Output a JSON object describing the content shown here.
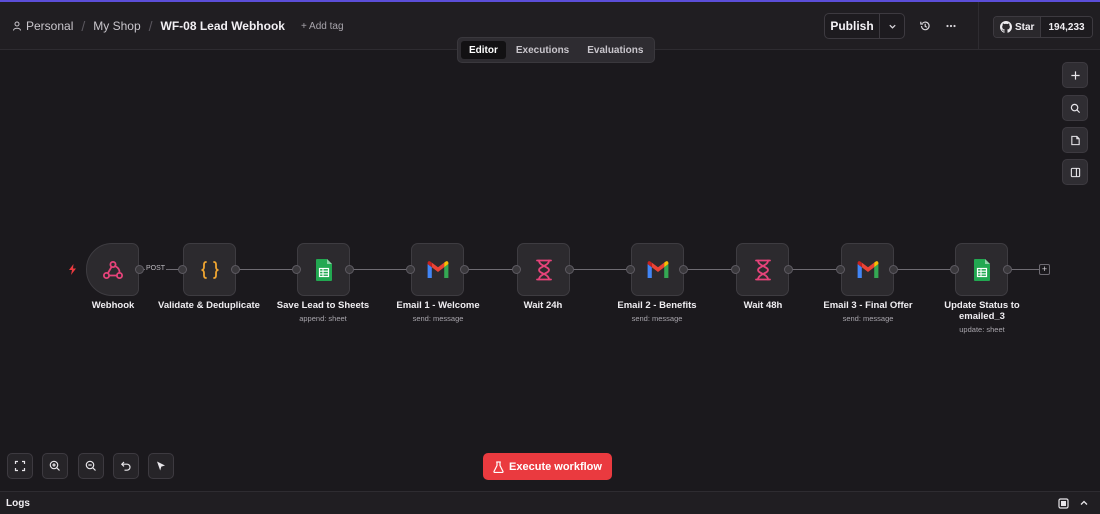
{
  "header": {
    "breadcrumb": [
      "Personal",
      "My Shop"
    ],
    "workflow_name": "WF-08 Lead Webhook",
    "add_tag": "+ Add tag",
    "publish_label": "Publish",
    "github_star": "Star",
    "github_count": "194,233"
  },
  "tabs": [
    {
      "label": "Editor",
      "active": true
    },
    {
      "label": "Executions",
      "active": false
    },
    {
      "label": "Evaluations",
      "active": false
    }
  ],
  "nodes": [
    {
      "label": "Webhook",
      "sub": "",
      "icon": "webhook-icon"
    },
    {
      "label": "Validate & Deduplicate",
      "sub": "",
      "icon": "code-braces-icon"
    },
    {
      "label": "Save Lead to Sheets",
      "sub": "append: sheet",
      "icon": "google-sheets-icon"
    },
    {
      "label": "Email 1 - Welcome",
      "sub": "send: message",
      "icon": "gmail-icon"
    },
    {
      "label": "Wait 24h",
      "sub": "",
      "icon": "hourglass-icon"
    },
    {
      "label": "Email 2 - Benefits",
      "sub": "send: message",
      "icon": "gmail-icon"
    },
    {
      "label": "Wait 48h",
      "sub": "",
      "icon": "hourglass-icon"
    },
    {
      "label": "Email 3 - Final Offer",
      "sub": "send: message",
      "icon": "gmail-icon"
    },
    {
      "label": "Update Status to emailed_3",
      "sub": "update: sheet",
      "icon": "google-sheets-icon"
    }
  ],
  "connection_label": "POST",
  "execute_label": "Execute workflow",
  "logs_label": "Logs",
  "colors": {
    "accent": "#ea3a3f",
    "webhook": "#e6437a",
    "code": "#f0a531",
    "sheets": "#22a851",
    "wait": "#e6437a"
  }
}
